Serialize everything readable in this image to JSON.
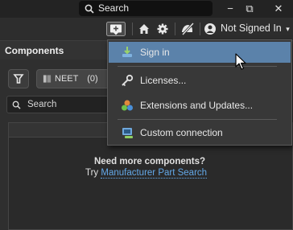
{
  "titlebar": {
    "search_placeholder": "Search",
    "minimize": "−",
    "restore": "⧉",
    "close": "✕"
  },
  "toolbar": {
    "account_label": "Not Signed In",
    "account_caret": "▾"
  },
  "panel": {
    "title": "Components",
    "filter_chip_label": "NEET",
    "filter_chip_count": "(0)",
    "search_placeholder": "Search",
    "empty_line1": "Need more components?",
    "empty_line2_prefix": "Try ",
    "empty_link": "Manufacturer Part Search"
  },
  "menu": {
    "items": [
      {
        "label": "Sign in",
        "icon": "sign-in-icon",
        "highlighted": true
      },
      {
        "label": "Licenses...",
        "icon": "key-icon"
      },
      {
        "label": "Extensions and Updates...",
        "icon": "extensions-icon"
      },
      {
        "label": "Custom connection",
        "icon": "custom-connection-icon"
      }
    ]
  },
  "colors": {
    "menu_highlight": "#5b82aa",
    "link": "#63a8e8",
    "background": "#2b2b2b"
  }
}
